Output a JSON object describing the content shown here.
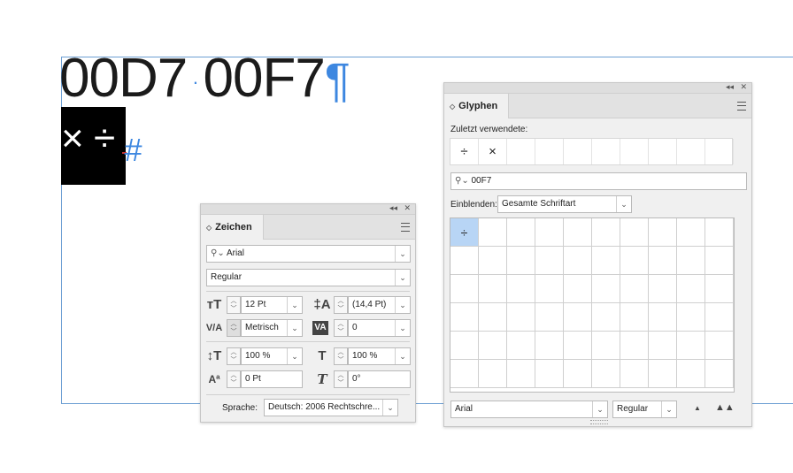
{
  "document": {
    "line1_a": "00D7",
    "line1_dot": "·",
    "line1_b": "00F7",
    "pilcrow": "¶",
    "glyph_times": "×",
    "glyph_divide": "÷",
    "hash": "#"
  },
  "zeichen": {
    "panel_controls": {
      "collapse": "◂◂",
      "close": "✕"
    },
    "tab_label": "Zeichen",
    "font_family": "Arial",
    "font_style": "Regular",
    "font_size": "12 Pt",
    "leading": "(14,4 Pt)",
    "kerning": "Metrisch",
    "tracking": "0",
    "vertical_scale": "100 %",
    "horizontal_scale": "100 %",
    "baseline_shift": "0 Pt",
    "skew": "0°",
    "language_label": "Sprache:",
    "language_value": "Deutsch: 2006 Rechtschre..."
  },
  "glyphen": {
    "panel_controls": {
      "collapse": "◂◂",
      "close": "✕"
    },
    "tab_label": "Glyphen",
    "recent_label": "Zuletzt verwendete:",
    "recent_glyphs": [
      "÷",
      "×"
    ],
    "search_value": "00F7",
    "show_label": "Einblenden:",
    "show_value": "Gesamte Schriftart",
    "grid_glyphs": [
      "÷"
    ],
    "font_family": "Arial",
    "font_style": "Regular"
  },
  "colors": {
    "selection_blue": "#b8d5f5",
    "frame_blue": "#6d9fd3",
    "hidden_char_blue": "#3d87e0"
  }
}
